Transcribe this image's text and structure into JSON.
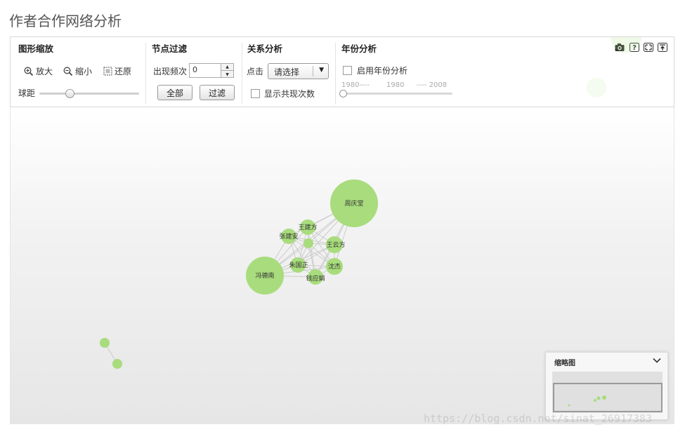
{
  "page": {
    "title": "作者合作网络分析"
  },
  "toolbar": {
    "zoom": {
      "title": "图形缩放",
      "zoom_in": "放大",
      "zoom_out": "缩小",
      "reset": "还原",
      "slider_label": "球距"
    },
    "filter": {
      "title": "节点过滤",
      "label": "出现频次",
      "value": "0",
      "all_button": "全部",
      "filter_button": "过滤"
    },
    "relation": {
      "title": "关系分析",
      "click_label": "点击",
      "select_value": "请选择",
      "show_count_label": "显示共现次数"
    },
    "year": {
      "title": "年份分析",
      "enable_label": "启用年份分析",
      "scale_start": "1980----",
      "scale_mid": "1980",
      "scale_end": "---- 2008",
      "enabled": false
    },
    "icons": [
      "camera-icon",
      "help-icon",
      "fullscreen-icon",
      "pin-icon"
    ]
  },
  "graph": {
    "node_color": "#a8dc7c",
    "edge_color": "#cccccc",
    "nodes": [
      {
        "id": "n1",
        "label": "周庆堂"
      },
      {
        "id": "n2",
        "label": "王建方"
      },
      {
        "id": "n3",
        "label": "张建安"
      },
      {
        "id": "n4",
        "label": ""
      },
      {
        "id": "n5",
        "label": "王云方"
      },
      {
        "id": "n6",
        "label": "朱国正"
      },
      {
        "id": "n7",
        "label": "沈杰"
      },
      {
        "id": "n8",
        "label": "钱应娟"
      },
      {
        "id": "n9",
        "label": "冯德南"
      },
      {
        "id": "n10",
        "label": ""
      },
      {
        "id": "n11",
        "label": ""
      }
    ]
  },
  "minimap": {
    "title": "缩略图"
  },
  "watermark": "https://blog.csdn.net/sinat_26917383"
}
